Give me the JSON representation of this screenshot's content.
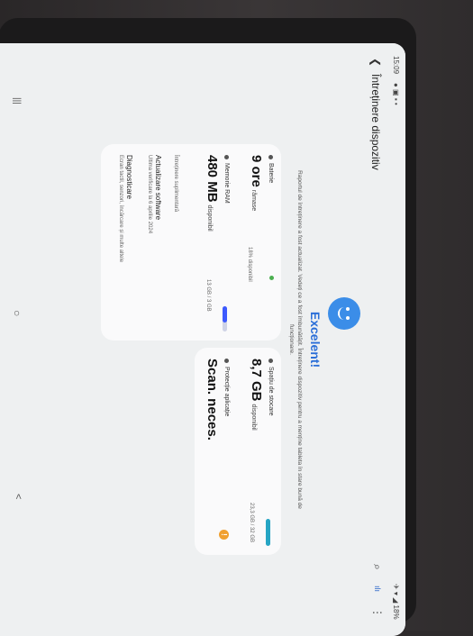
{
  "status_bar": {
    "time": "15:09",
    "right": "18%"
  },
  "header": {
    "title": "Întreținere dispozitiv"
  },
  "hero": {
    "title": "Excelent!",
    "message": "Raportul de întreținere a fost actualizat. Vedeți ce a fost îmbunătățit. Întreținere dispozitiv pentru a menține tableta în stare bună de funcționare."
  },
  "battery": {
    "label": "Baterie",
    "value": "9 ore",
    "unit": "rămase",
    "color": "#4caf50"
  },
  "storage": {
    "label": "Spațiu de stocare",
    "value": "8,7 GB",
    "unit": "disponibil",
    "detail": "23,3 GB / 32 GB",
    "color": "#26a5c4"
  },
  "ram": {
    "label": "Memorie RAM",
    "value": "480 MB",
    "unit": "disponibil",
    "detail": "13 GB / 3 GB",
    "color": "#3d5afe"
  },
  "protection": {
    "label": "Protecție aplicație",
    "value": "Scan. neces.",
    "color": "#f0a030"
  },
  "battery_extra": {
    "percent": "18% disponibil"
  },
  "extra": {
    "section_title": "Întreținere suplimentară",
    "items": [
      {
        "title": "Actualizare software",
        "subtitle": "Ultima verificare la 6 aprilie 2024"
      },
      {
        "title": "Diagnosticare",
        "subtitle": "Ecran tactil, senzori, încărcare și multe altele"
      }
    ]
  },
  "nav": {
    "recent": "|||",
    "home": "○",
    "back": "<"
  }
}
